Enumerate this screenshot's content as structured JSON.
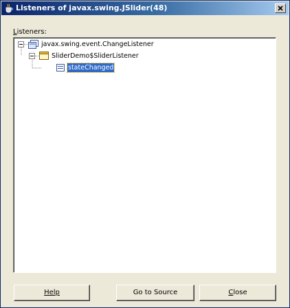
{
  "window": {
    "title": "Listeners of javax.swing.JSlider(48)",
    "title_icon": "java-cup-icon",
    "close_glyph": "x"
  },
  "listeners_label": "Listeners:",
  "tree": [
    {
      "label": "javax.swing.event.ChangeListener",
      "icon": "interface-icon",
      "expanded": true,
      "selected": false
    },
    {
      "label": "SliderDemo$SliderListener",
      "icon": "class-icon",
      "expanded": true,
      "selected": false
    },
    {
      "label": "stateChanged",
      "icon": "method-icon",
      "expanded": false,
      "selected": true
    }
  ],
  "buttons": {
    "help": "Help",
    "go_to_source": "Go to Source",
    "close": "Close"
  },
  "colors": {
    "titlebar_start": "#0a246a",
    "titlebar_end": "#a6caf0",
    "selection": "#316ac5",
    "dialog_bg": "#ece9d8"
  }
}
